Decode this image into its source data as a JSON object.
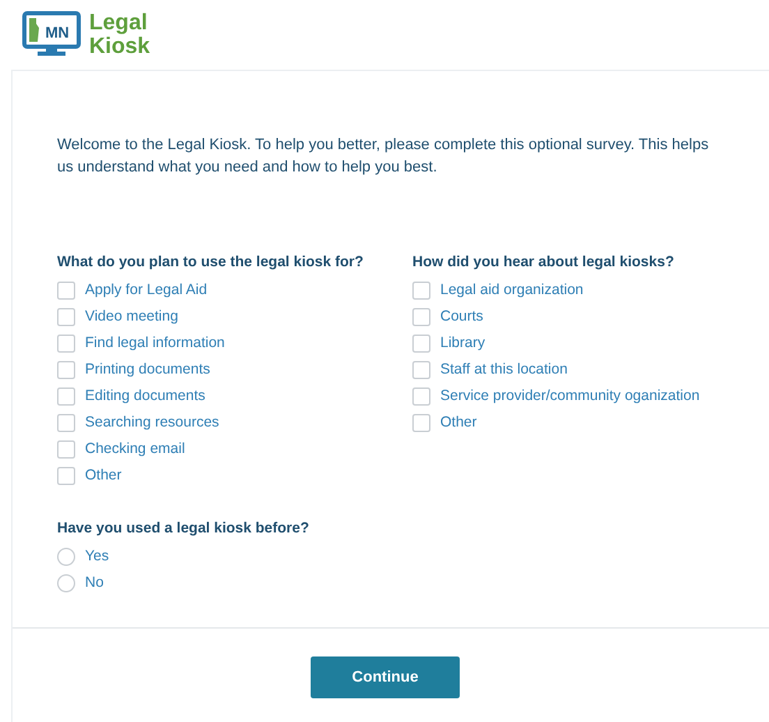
{
  "header": {
    "logo_badge": "MN",
    "logo_text": [
      "Legal",
      "Kiosk"
    ]
  },
  "intro": "Welcome to the Legal Kiosk. To help you better, please complete this optional survey. This helps us understand what you need and how to help you best.",
  "questions": [
    {
      "title": "What do you plan to use the legal kiosk for?",
      "kind": "checkbox",
      "options": [
        {
          "label": "Apply for Legal Aid",
          "checked": false
        },
        {
          "label": "Video meeting",
          "checked": false
        },
        {
          "label": "Find legal information",
          "checked": false
        },
        {
          "label": "Printing documents",
          "checked": false
        },
        {
          "label": "Editing documents",
          "checked": false
        },
        {
          "label": "Searching resources",
          "checked": false
        },
        {
          "label": "Checking email",
          "checked": false
        },
        {
          "label": "Other",
          "checked": false
        }
      ]
    },
    {
      "title": "How did you hear about legal kiosks?",
      "kind": "checkbox",
      "options": [
        {
          "label": "Legal aid organization",
          "checked": false
        },
        {
          "label": "Courts",
          "checked": false
        },
        {
          "label": "Library",
          "checked": false
        },
        {
          "label": "Staff at this location",
          "checked": false
        },
        {
          "label": "Service provider/community oganization",
          "checked": false
        },
        {
          "label": "Other",
          "checked": false
        }
      ]
    },
    {
      "title": "Have you used a legal kiosk before?",
      "kind": "radio",
      "options": [
        {
          "label": "Yes",
          "selected": false
        },
        {
          "label": "No",
          "selected": false
        }
      ]
    }
  ],
  "continue_button": "Continue"
}
